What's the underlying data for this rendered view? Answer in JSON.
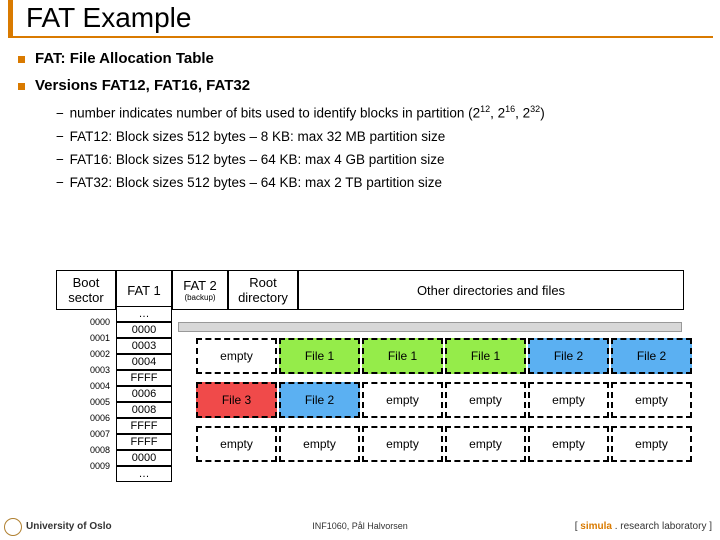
{
  "title": "FAT Example",
  "bullets": {
    "main": [
      "FAT: File Allocation Table",
      "Versions FAT12, FAT16, FAT32"
    ],
    "sub_html": [
      "number indicates number of bits used to identify blocks in partition (2<sup>12</sup>, 2<sup>16</sup>, 2<sup>32</sup>)",
      "FAT12: Block sizes 512 bytes – 8 KB: max 32 MB partition size",
      "FAT16: Block sizes 512 bytes – 64 KB: max 4 GB partition size",
      "FAT32: Block sizes 512 bytes – 64 KB: max 2 TB partition size"
    ]
  },
  "headers": {
    "boot": "Boot sector",
    "fat1": "FAT 1",
    "fat2": "FAT 2",
    "fat2_sub": "(backup)",
    "root": "Root directory",
    "other": "Other directories and files"
  },
  "fat_table": {
    "index_labels": [
      "0000",
      "0001",
      "0002",
      "0003",
      "0004",
      "0005",
      "0006",
      "0007",
      "0008",
      "0009"
    ],
    "entries": [
      "…",
      "0000",
      "0003",
      "0004",
      "FFFF",
      "0006",
      "0008",
      "FFFF",
      "FFFF",
      "0000",
      "…"
    ]
  },
  "panes": [
    [
      "empty",
      "File 1",
      "File 1",
      "File 1",
      "File 2",
      "File 2"
    ],
    [
      "File 3",
      "File 2",
      "empty",
      "empty",
      "empty",
      "empty"
    ],
    [
      "empty",
      "empty",
      "empty",
      "empty",
      "empty",
      "empty"
    ]
  ],
  "pane_classes": [
    [
      "empty",
      "file1",
      "file1",
      "file1",
      "file2",
      "file2"
    ],
    [
      "file3",
      "file2",
      "empty",
      "empty",
      "empty",
      "empty"
    ],
    [
      "empty",
      "empty",
      "empty",
      "empty",
      "empty",
      "empty"
    ]
  ],
  "footer": {
    "uni": "University of Oslo",
    "mid": "INF1060, Pål Halvorsen",
    "lab_prefix": "[ ",
    "lab_brand": "simula",
    "lab_suffix": " . research laboratory ]"
  }
}
